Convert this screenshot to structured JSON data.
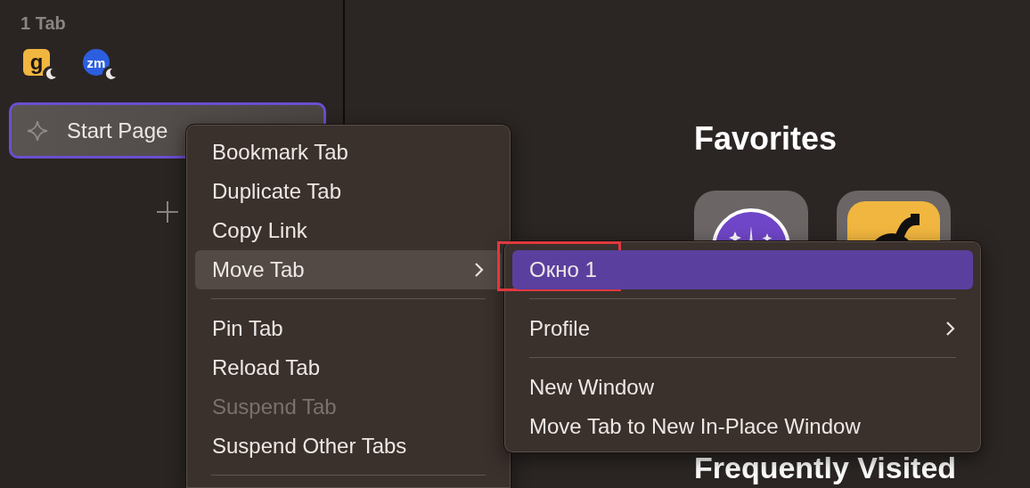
{
  "sidebar": {
    "tab_count": "1 Tab",
    "pinned_tabs": [
      {
        "glyph": "g",
        "kind": "square",
        "suspended": true
      },
      {
        "glyph": "zm",
        "kind": "bubble",
        "suspended": true
      }
    ],
    "tabs": [
      {
        "label": "Start Page",
        "selected": true
      }
    ]
  },
  "start_page": {
    "favorites_title": "Favorites",
    "favorites": [
      {
        "kind": "compass"
      },
      {
        "kind": "hook"
      }
    ],
    "frequently_visited_title": "Frequently Visited"
  },
  "context_menu": {
    "items": [
      {
        "kind": "item",
        "label": "Bookmark Tab",
        "disabled": false,
        "highlighted": false
      },
      {
        "kind": "item",
        "label": "Duplicate Tab",
        "disabled": false,
        "highlighted": false
      },
      {
        "kind": "item",
        "label": "Copy Link",
        "disabled": false,
        "highlighted": false
      },
      {
        "kind": "submenu",
        "label": "Move Tab",
        "disabled": false,
        "highlighted": true
      },
      {
        "kind": "separator"
      },
      {
        "kind": "item",
        "label": "Pin Tab",
        "disabled": false,
        "highlighted": false
      },
      {
        "kind": "item",
        "label": "Reload Tab",
        "disabled": false,
        "highlighted": false
      },
      {
        "kind": "item",
        "label": "Suspend Tab",
        "disabled": true,
        "highlighted": false
      },
      {
        "kind": "item",
        "label": "Suspend Other Tabs",
        "disabled": false,
        "highlighted": false
      },
      {
        "kind": "separator"
      }
    ]
  },
  "submenu": {
    "items": [
      {
        "kind": "item",
        "label": "Окно 1",
        "disabled": false,
        "highlighted": true,
        "annotated": true
      },
      {
        "kind": "separator"
      },
      {
        "kind": "submenu",
        "label": "Profile",
        "disabled": false,
        "highlighted": false,
        "annotated": false
      },
      {
        "kind": "separator"
      },
      {
        "kind": "item",
        "label": "New Window",
        "disabled": false,
        "highlighted": false,
        "annotated": false
      },
      {
        "kind": "item",
        "label": "Move Tab to New In-Place Window",
        "disabled": false,
        "highlighted": false,
        "annotated": false
      }
    ]
  }
}
